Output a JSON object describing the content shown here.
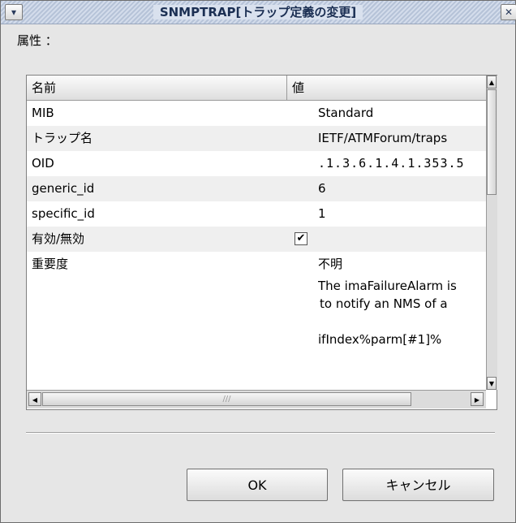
{
  "window": {
    "title": "SNMPTRAP[トラップ定義の変更]"
  },
  "attributes_label": "属性 ：",
  "table": {
    "columns": [
      "名前",
      "値"
    ],
    "rows": [
      {
        "name": "MIB",
        "value": "Standard"
      },
      {
        "name": "トラップ名",
        "value": "IETF/ATMForum/traps"
      },
      {
        "name": "OID",
        "value": ".1.3.6.1.4.1.353.5"
      },
      {
        "name": "generic_id",
        "value": "6"
      },
      {
        "name": "specific_id",
        "value": "1"
      },
      {
        "name": "有効/無効",
        "value": "✔",
        "checked": true
      },
      {
        "name": "重要度",
        "value": "不明"
      }
    ],
    "description_lines": [
      "The imaFailureAlarm is",
      "to notify an NMS of a",
      "",
      "ifIndex%parm[#1]%"
    ]
  },
  "buttons": {
    "ok": "OK",
    "cancel": "キャンセル"
  }
}
